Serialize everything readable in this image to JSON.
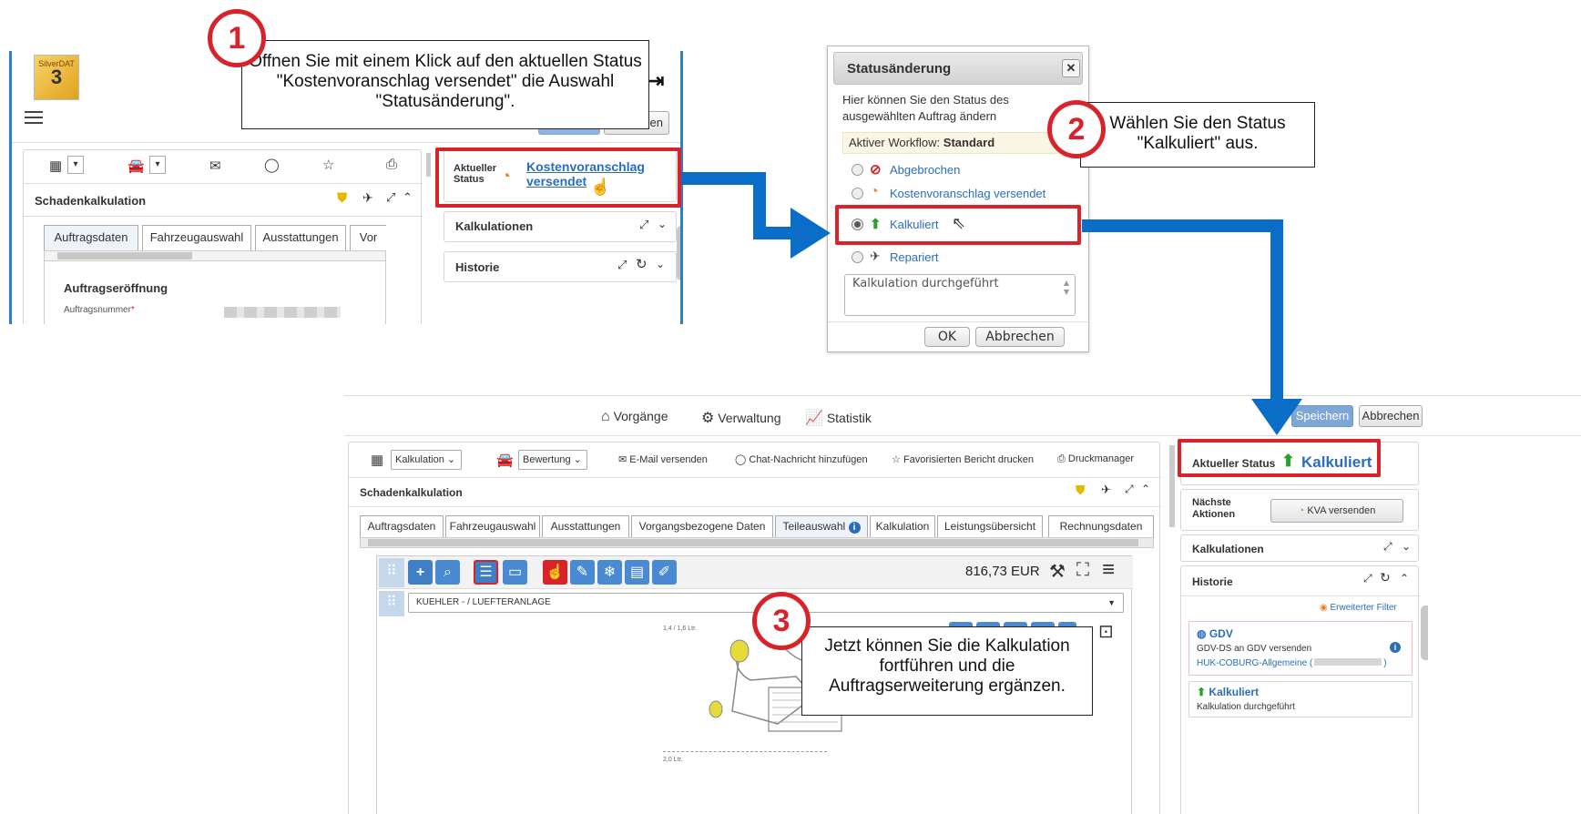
{
  "callouts": {
    "step1": {
      "number": "1",
      "text": "Öffnen Sie mit einem Klick auf  den aktuellen Status \"Kostenvoranschlag versendet\" die Auswahl \"Statusänderung\"."
    },
    "step2": {
      "number": "2",
      "text": "Wählen Sie den Status \"Kalkuliert\" aus."
    },
    "step3": {
      "number": "3",
      "text": "Jetzt können Sie die Kalkulation fortführen und die Auftragserweiterung ergänzen."
    }
  },
  "shot1": {
    "logo_top": "SilverDAT",
    "logo_num": "3",
    "right_button": "en",
    "section_title": "Schadenkalkulation",
    "tabs": [
      "Auftragsdaten",
      "Fahrzeugauswahl",
      "Ausstattungen",
      "Vor"
    ],
    "subheading": "Auftragseröffnung",
    "field_label": "Auftragsnummer",
    "required_mark": "*",
    "status_label_1": "Aktueller",
    "status_label_2": "Status",
    "status_value_1": "Kostenvoranschlag",
    "status_value_2": "versendet",
    "panel_kalkulationen": "Kalkulationen",
    "panel_historie": "Historie"
  },
  "dialog": {
    "title": "Statusänderung",
    "description": "Hier können Sie den Status des ausgewählten Auftrag ändern",
    "workflow_label": "Aktiver Workflow:",
    "workflow_value": "Standard",
    "options": [
      "Abgebrochen",
      "Kostenvoranschlag versendet",
      "Kalkuliert",
      "Repariert"
    ],
    "comment": "Kalkulation durchgeführt",
    "ok": "OK",
    "cancel": "Abbrechen"
  },
  "shot3": {
    "nav": [
      "Vorgänge",
      "Verwaltung",
      "Statistik"
    ],
    "save": "Speichern",
    "cancel": "Abbrechen",
    "toolbar": {
      "calc_select": "Kalkulation",
      "rating_select": "Bewertung",
      "email": "E-Mail versenden",
      "chat": "Chat-Nachricht hinzufügen",
      "fav": "Favorisierten Bericht drucken",
      "print": "Druckmanager"
    },
    "section_title": "Schadenkalkulation",
    "tabs": [
      "Auftragsdaten",
      "Fahrzeugauswahl",
      "Ausstattungen",
      "Vorgangsbezogene Daten",
      "Teileauswahl",
      "Kalkulation",
      "Leistungsübersicht",
      "Rechnungsdaten"
    ],
    "price": "816,73 EUR",
    "group_select": "KUEHLER - / LUEFTERANLAGE",
    "diagram_labels": [
      "1,4 / 1,6 Ltr.",
      "2,0 Ltr."
    ],
    "current_status_label": "Aktueller Status",
    "current_status_value": "Kalkuliert",
    "next_actions_label_1": "Nächste",
    "next_actions_label_2": "Aktionen",
    "kva_button": "KVA versenden",
    "panel_kalkulationen": "Kalkulationen",
    "panel_historie": "Historie",
    "extended_filter": "Erweiterter Filter",
    "history": [
      {
        "title": "GDV",
        "line1": "GDV-DS an GDV versenden",
        "line2": "HUK-COBURG-Allgemeine ("
      },
      {
        "title": "Kalkuliert",
        "line1": "Kalkulation durchgeführt"
      }
    ]
  },
  "colors": {
    "accent_red": "#d8232a",
    "arrow_blue": "#0a6ec8",
    "link_blue": "#2a6ebb",
    "rss_orange": "#f0821e",
    "status_green": "#2aa02a"
  }
}
